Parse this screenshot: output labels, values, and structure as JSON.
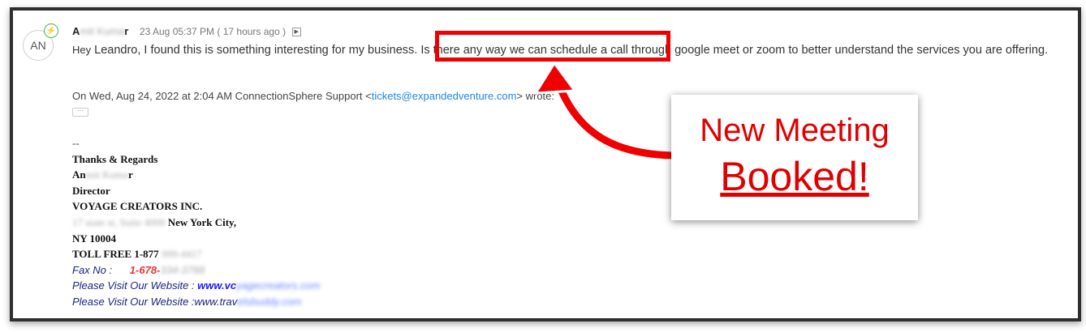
{
  "email": {
    "avatar_initials": "AN",
    "sender_name_visible_start": "A",
    "sender_name_blurred": "mit Kuma",
    "sender_name_visible_end": "r",
    "date": "23 Aug 05:37 PM ( 17 hours ago )",
    "greeting": "Hey",
    "body_before_highlight": "Leandro, I found this is something interesting for my business. ",
    "body_highlight": "Is there any way we can schedule a call t",
    "body_after_highlight": "hrough google meet or zoom to better understand the services you are offering.",
    "quote_prefix": "On Wed, Aug 24, 2022 at 2:04 AM ConnectionSphere Support <",
    "quote_email": "tickets@expandedventure.com",
    "quote_suffix": "> wrote:",
    "ellipsis": "···"
  },
  "signature": {
    "dash": "--",
    "regards": "Thanks & Regards",
    "name_start": "An",
    "name_blurred": "mit Kuma",
    "name_end": "r",
    "title": "Director",
    "company": "VOYAGE CREATORS INC.",
    "address_blurred": "17 state st, Suite 4000",
    "city": " New York City,",
    "state_zip": "NY 10004",
    "tollfree_label": "TOLL FREE 1-877",
    "tollfree_blurred": " 999-4417",
    "fax_label": "Fax No :",
    "fax_number": "1-678-",
    "fax_blurred": "334-3788",
    "website1_label": "Please Visit Our Website : ",
    "website1_link": "www.vc",
    "website1_blurred": "yagecreators.com",
    "website2_label": "Please Visit Our Website :",
    "website2_link": "www.trav",
    "website2_blurred": "elsbuddy.com"
  },
  "callout": {
    "line1": "New Meeting",
    "line2": "Booked!"
  },
  "colors": {
    "highlight": "#f00000",
    "callout_text": "#e00000",
    "link": "#1e88e5"
  }
}
